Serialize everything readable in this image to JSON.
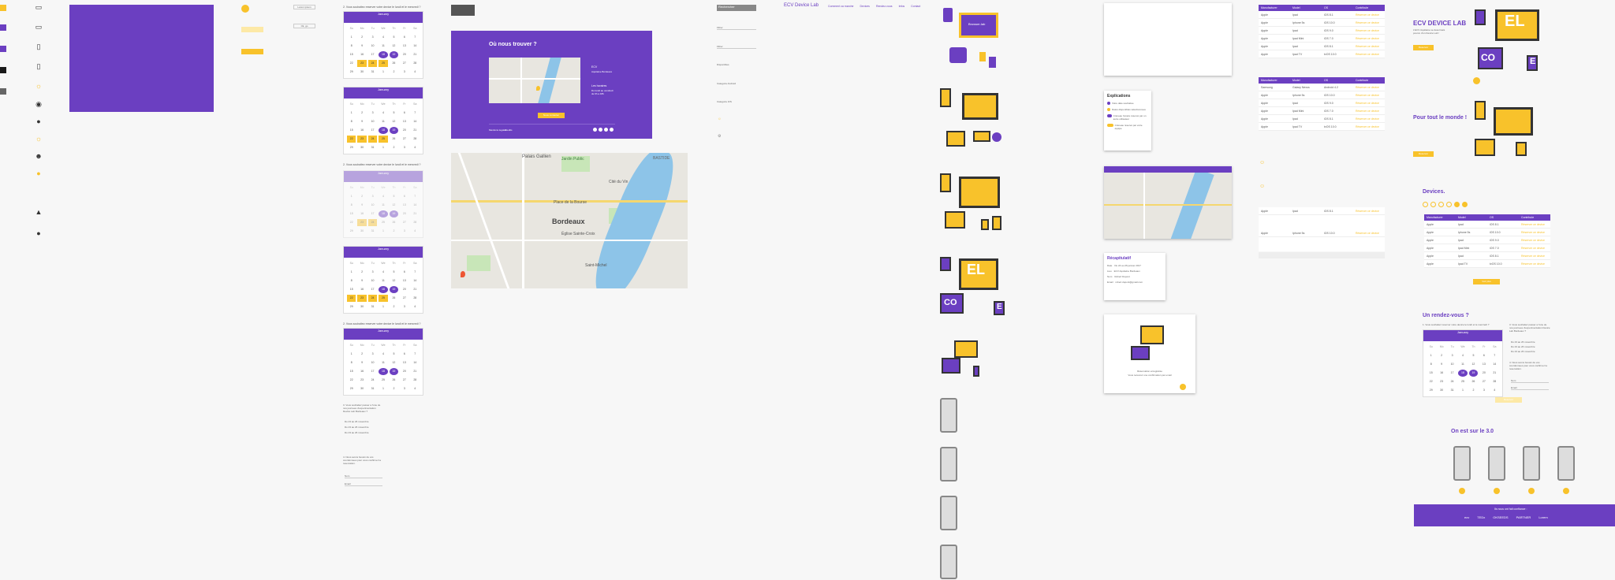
{
  "styleguide": {
    "colors": [
      "#f8c22b",
      "#6b3fc1",
      "#6b3fc1",
      "#1a1a1a",
      "#666666"
    ],
    "icons": [
      "laptop-icon",
      "laptop-icon",
      "phone-icon",
      "tablet-icon",
      "sun-icon",
      "watch-icon",
      "dot-icon",
      "sun-icon",
      "user-icon",
      "map-pin-icon",
      "android-icon",
      "apple-icon"
    ]
  },
  "buttons": {
    "primary": "",
    "secondary": "",
    "outline1": "Lorem ipsum",
    "outline2": "Ok, go"
  },
  "calendar": {
    "question": "2. Vous souhaitez reserver votre device le lundi et le mercredi ?",
    "month": "January",
    "days": [
      "Su",
      "Mo",
      "Tu",
      "We",
      "Th",
      "Fr",
      "Sa"
    ],
    "dates": [
      "1",
      "2",
      "3",
      "4",
      "5",
      "6",
      "7",
      "8",
      "9",
      "10",
      "11",
      "12",
      "13",
      "14",
      "15",
      "16",
      "17",
      "18",
      "19",
      "20",
      "21",
      "22",
      "23",
      "24",
      "25",
      "26",
      "27",
      "28",
      "29",
      "30",
      "31",
      "1",
      "2",
      "3",
      "4"
    ]
  },
  "form": {
    "q3": "3. Vous souhaitez passer a l'une de nos journees d'experimentation Device Lab Bordeaux ?",
    "opt1": "Du 23 au 26 novembre",
    "opt2": "Du 23 au 26 novembre",
    "opt3": "Du 23 au 26 novembre",
    "q4": "4. Nous avons besoin de vos coordonnees pour vous confirmer la reservation.",
    "name": "Nom",
    "email": "Email"
  },
  "find": {
    "title": "Où nous trouver ?",
    "addr_label": "ECV",
    "addr": "Aquitaine Bordeaux",
    "hours_label": "Les horaires",
    "hours": "Du lundi au vendredi de 9h a 18h",
    "cta": "Nous contacter",
    "legal": "Mentions legales",
    "credits": "Credits"
  },
  "sidebar": {
    "search": "Rechercher",
    "filter": "Filtrer",
    "lbl1": "Disponibles",
    "lbl2": "Categorie Android",
    "lbl3": "Categorie iOS"
  },
  "nav": {
    "brand": "ECV Device Lab",
    "items": [
      "Comment ca marche",
      "Devices",
      "Rendez-vous",
      "Infos",
      "Contact"
    ]
  },
  "map": {
    "place1": "Palais Gallien",
    "place2": "Jardin Public",
    "place3": "Bordeaux",
    "place4": "Cité du Vin",
    "place5": "Saint-Michel",
    "place6": "BASTIDE",
    "place7": "Place de la Bourse",
    "place8": "Église Sainte-Croix"
  },
  "legend": {
    "title": "Explications",
    "l1": "Votre date souhaitée",
    "l2": "Dates disponibles sélectionnées",
    "l3": "Créneau horaire réservé par un autre utilisateur",
    "l4": "Créneau réservé par votre équipe"
  },
  "recap": {
    "title": "Récapitulatif",
    "date_l": "Date",
    "date": "Du 24 au 26 janvier 2017",
    "lieu_l": "Lieu",
    "lieu": "ECV Aquitaine Bordeaux",
    "nom_l": "Nom",
    "nom": "Robert Dupont",
    "mail_l": "Email",
    "mail": "robert.dupont@gmail.com"
  },
  "confirm": {
    "title": "Réservation enregistrée",
    "text": "Vous recevrez une confirmation par email"
  },
  "table": {
    "headers": [
      "Manufacturer",
      "Model",
      "OS",
      "Contribute"
    ],
    "rows": [
      [
        "Apple",
        "Ipad",
        "iOS 8.1",
        "Réserver ce device"
      ],
      [
        "Apple",
        "Iphone 5s",
        "iOS 10.0",
        "Réserver ce device"
      ],
      [
        "Apple",
        "Ipad",
        "iOS 9.0",
        "Réserver ce device"
      ],
      [
        "Apple",
        "Ipad Mini",
        "iOS 7.0",
        "Réserver ce device"
      ],
      [
        "Apple",
        "Ipad",
        "iOS 8.1",
        "Réserver ce device"
      ],
      [
        "Apple",
        "Ipad TV",
        "tvOS 10.0",
        "Réserver ce device"
      ]
    ],
    "rows2": [
      [
        "Samsung",
        "Galaxy Nexus",
        "Android 4.2",
        "Réserver ce device"
      ],
      [
        "Apple",
        "Iphone 5s",
        "iOS 10.0",
        "Réserver ce device"
      ],
      [
        "Apple",
        "Ipad",
        "iOS 9.0",
        "Réserver ce device"
      ],
      [
        "Apple",
        "Ipad Mini",
        "iOS 7.0",
        "Réserver ce device"
      ],
      [
        "Apple",
        "Ipad",
        "iOS 8.1",
        "Réserver ce device"
      ],
      [
        "Apple",
        "Ipad TV",
        "tvOS 10.0",
        "Réserver ce device"
      ]
    ]
  },
  "landing": {
    "hero": "ECV DEVICE LAB",
    "hero_sub": "L'ECV Aquitaine se desormais pourvu d'un Device Lab !",
    "hero_btn": "Reserver",
    "world": "Pour tout le monde !",
    "world_btn": "Reserver",
    "devices": "Devices.",
    "devices_btn": "Voir plus",
    "rdv": "Un rendez-vous ?",
    "rdv_q": "1. Vous souhaitez reserver votre device le lundi et le mercredi ?",
    "rdv_btn": "Reserver",
    "web3": "On est sur le 3.0",
    "footer": "Ils nous ont fait confiance :",
    "partners": [
      "ecv",
      "TEDx",
      "OKSEEDS",
      "PARTNER",
      "Lorem"
    ]
  },
  "illus_text": {
    "browser": "Browser-lab",
    "el": "EL",
    "co": "CO",
    "e": "E"
  }
}
